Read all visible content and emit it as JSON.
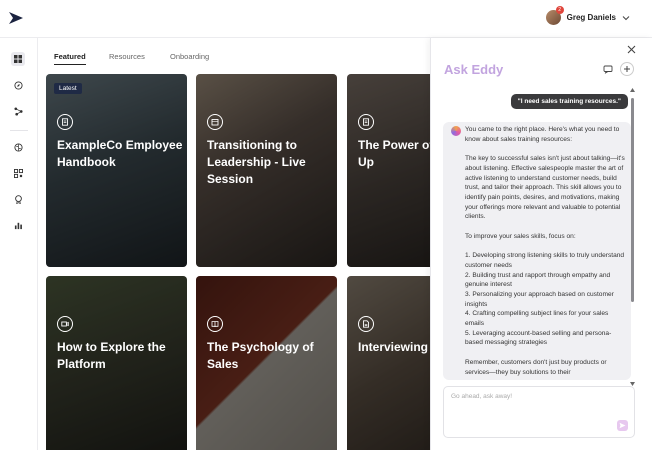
{
  "user": {
    "name": "Greg Daniels",
    "notifications": "2"
  },
  "nav": {
    "icons": [
      "dashboard-icon",
      "compass-icon",
      "network-icon",
      "brain-icon",
      "qr-code-icon",
      "award-icon",
      "analytics-icon"
    ]
  },
  "tabs": [
    {
      "label": "Featured",
      "active": true
    },
    {
      "label": "Resources",
      "active": false
    },
    {
      "label": "Onboarding",
      "active": false
    }
  ],
  "cards": [
    {
      "badge": "Latest",
      "title": "ExampleCo Employee Handbook",
      "icon": "document-icon"
    },
    {
      "title": "Transitioning to Leadership - Live Session",
      "icon": "calendar-icon"
    },
    {
      "title": "The Power of Follow-Up",
      "icon": "document-icon"
    },
    {
      "title": "How to Explore the Platform",
      "icon": "video-icon"
    },
    {
      "title": "The Psychology of Sales",
      "icon": "book-icon"
    },
    {
      "title": "Interviewing Hiring",
      "icon": "file-icon"
    }
  ],
  "panel": {
    "title": "Ask Eddy",
    "user_message": "\"I need sales training resources.\"",
    "bot_paragraphs": [
      "You came to the right place. Here's what you need to know about sales training resources:",
      "The key to successful sales isn't just about talking—it's about listening. Effective salespeople master the art of active listening to understand customer needs, build trust, and tailor their approach. This skill allows you to identify pain points, desires, and motivations, making your offerings more relevant and valuable to potential clients.",
      "To improve your sales skills, focus on:",
      "1. Developing strong listening skills to truly understand customer needs\n2. Building trust and rapport through empathy and genuine interest\n3. Personalizing your approach based on customer insights\n4. Crafting compelling subject lines for your sales emails\n5. Leveraging account-based selling and persona-based messaging strategies",
      "Remember, customers don't just buy products or services—they buy solutions to their"
    ],
    "composer_placeholder": "Go ahead, ask away!"
  },
  "colors": {
    "accent": "#c2a4df",
    "dark_badge": "#1f2a45"
  }
}
